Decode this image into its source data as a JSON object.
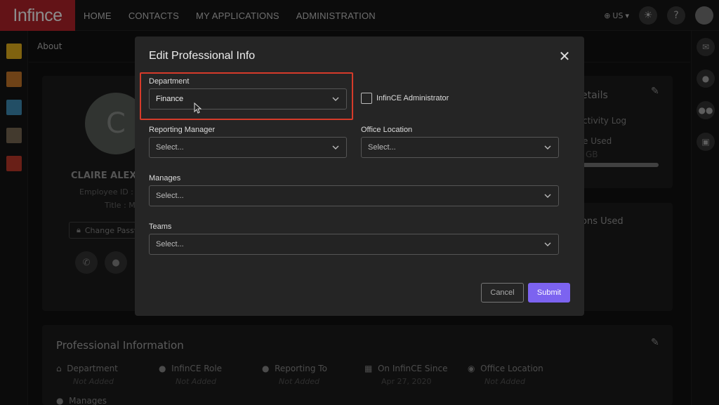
{
  "topbar": {
    "logo": "Infince",
    "nav": [
      "HOME",
      "CONTACTS",
      "MY APPLICATIONS",
      "ADMINISTRATION"
    ],
    "locale": "US"
  },
  "subheader": {
    "title": "About"
  },
  "profile": {
    "initial": "C",
    "name": "CLAIRE ALEX",
    "employee_id": "Employee ID : E",
    "title": "Title : M",
    "change_password": "Change Passw"
  },
  "right_card": {
    "details_heading": "etails",
    "activity_log": "ctivity Log",
    "used": "e Used",
    "gb": "GB",
    "ons_used": "ons Used"
  },
  "professional_info": {
    "heading": "Professional Information",
    "fields": [
      {
        "label": "Department",
        "value": "Not Added"
      },
      {
        "label": "InfinCE Role",
        "value": "Not Added"
      },
      {
        "label": "Reporting To",
        "value": "Not Added"
      },
      {
        "label": "On InfinCE Since",
        "value": "Apr 27, 2020"
      },
      {
        "label": "Office Location",
        "value": "Not Added"
      }
    ],
    "manages_label": "Manages"
  },
  "modal": {
    "title": "Edit Professional Info",
    "department_label": "Department",
    "department_value": "Finance",
    "admin_label": "InfinCE Administrator",
    "admin_checked": false,
    "reporting_manager_label": "Reporting Manager",
    "reporting_manager_placeholder": "Select...",
    "office_location_label": "Office Location",
    "office_location_placeholder": "Select...",
    "manages_label": "Manages",
    "manages_placeholder": "Select...",
    "teams_label": "Teams",
    "teams_placeholder": "Select...",
    "cancel_label": "Cancel",
    "submit_label": "Submit"
  },
  "colors": {
    "brand": "#b5232a",
    "accent": "#7c63f0",
    "highlight": "#d63b2a"
  }
}
